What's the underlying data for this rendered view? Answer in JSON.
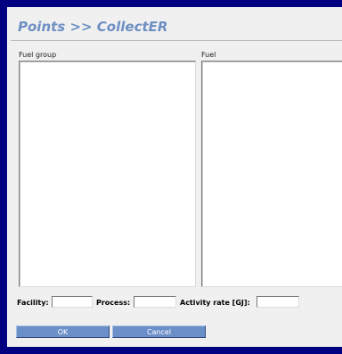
{
  "header": {
    "title": "Points >> CollectER"
  },
  "lists": {
    "fuel_group": {
      "label": "Fuel group",
      "items": []
    },
    "fuel": {
      "label": "Fuel",
      "items": []
    }
  },
  "fields": {
    "facility": {
      "label": "Facility:",
      "value": ""
    },
    "process": {
      "label": "Process:",
      "value": ""
    },
    "activity_rate": {
      "label": "Activity rate [GJ]:",
      "value": ""
    }
  },
  "buttons": {
    "ok_label": "OK",
    "cancel_label": "Cancel"
  },
  "colors": {
    "frame": "#000080",
    "panel": "#f0f0f0",
    "title": "#6e8fc2",
    "button": "#6b8fc8"
  }
}
